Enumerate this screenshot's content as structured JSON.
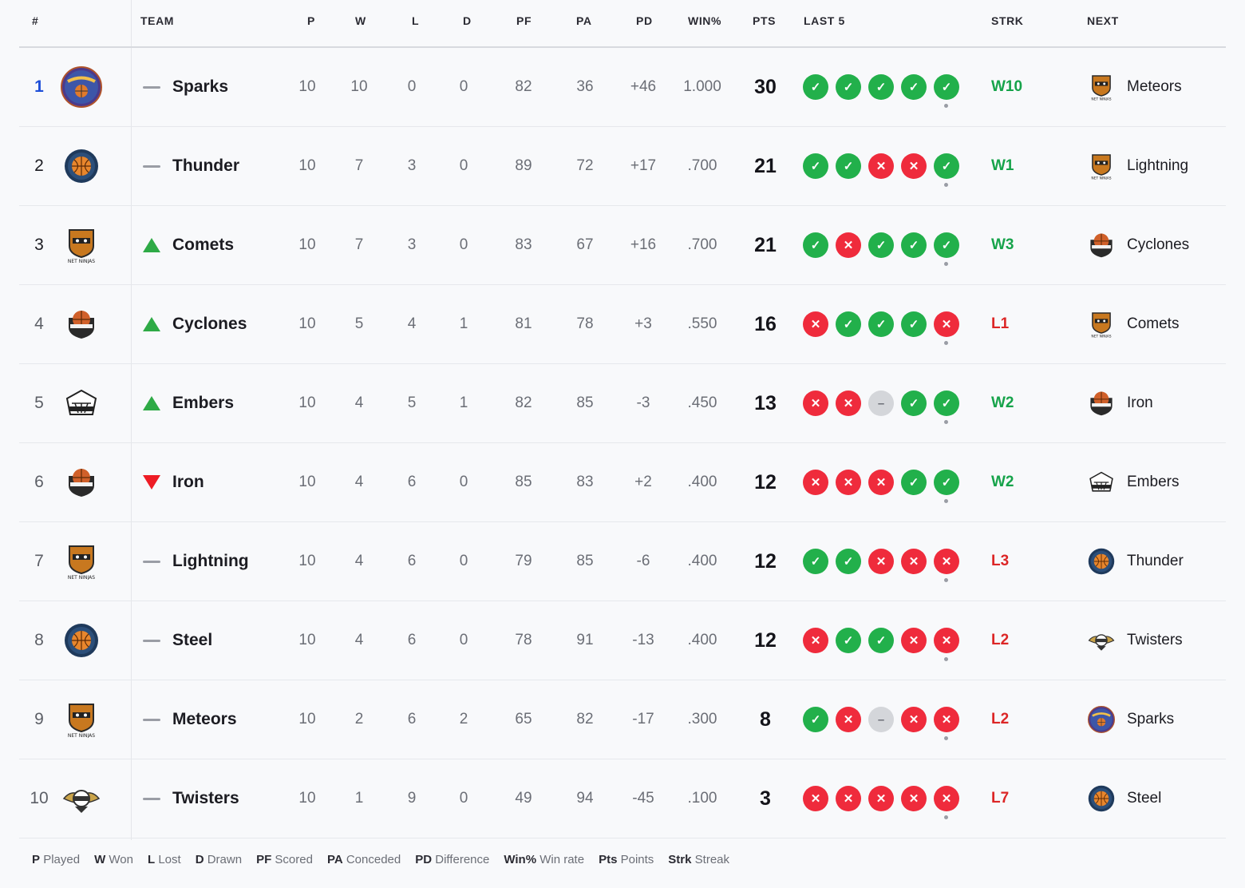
{
  "headers": {
    "rank": "#",
    "team": "TEAM",
    "p": "P",
    "w": "W",
    "l": "L",
    "d": "D",
    "pf": "PF",
    "pa": "PA",
    "pd": "PD",
    "winpct": "WIN%",
    "pts": "PTS",
    "last5": "LAST 5",
    "strk": "STRK",
    "next": "NEXT"
  },
  "colors": {
    "win": "#22b04b",
    "loss": "#ef2b3c",
    "draw": "#d4d6da",
    "rank_first": "#1d4ed8",
    "up": "#2eaa46",
    "down": "#ee1c25"
  },
  "rows": [
    {
      "rank": "1",
      "logo": "alley-oops-logo",
      "trend": "flat",
      "team": "Sparks",
      "p": "10",
      "w": "10",
      "l": "0",
      "d": "0",
      "pf": "82",
      "pa": "36",
      "pd": "+46",
      "winpct": "1.000",
      "pts": "30",
      "last5": [
        "W",
        "W",
        "W",
        "W",
        "W"
      ],
      "strk": "W10",
      "next": "Meteors",
      "next_logo": "net-ninjas-logo"
    },
    {
      "rank": "2",
      "logo": "basketball-logo",
      "trend": "flat",
      "team": "Thunder",
      "p": "10",
      "w": "7",
      "l": "3",
      "d": "0",
      "pf": "89",
      "pa": "72",
      "pd": "+17",
      "winpct": ".700",
      "pts": "21",
      "last5": [
        "W",
        "W",
        "L",
        "L",
        "W"
      ],
      "strk": "W1",
      "next": "Lightning",
      "next_logo": "net-ninjas-logo"
    },
    {
      "rank": "3",
      "logo": "net-ninjas-logo",
      "trend": "up",
      "team": "Comets",
      "p": "10",
      "w": "7",
      "l": "3",
      "d": "0",
      "pf": "83",
      "pa": "67",
      "pd": "+16",
      "winpct": ".700",
      "pts": "21",
      "last5": [
        "W",
        "L",
        "W",
        "W",
        "W"
      ],
      "strk": "W3",
      "next": "Cyclones",
      "next_logo": "shield-ball-logo"
    },
    {
      "rank": "4",
      "logo": "shield-ball-logo",
      "trend": "up",
      "team": "Cyclones",
      "p": "10",
      "w": "5",
      "l": "4",
      "d": "1",
      "pf": "81",
      "pa": "78",
      "pd": "+3",
      "winpct": ".550",
      "pts": "16",
      "last5": [
        "L",
        "W",
        "W",
        "W",
        "L"
      ],
      "strk": "L1",
      "next": "Comets",
      "next_logo": "net-ninjas-logo"
    },
    {
      "rank": "5",
      "logo": "hoop-badge-logo",
      "trend": "up",
      "team": "Embers",
      "p": "10",
      "w": "4",
      "l": "5",
      "d": "1",
      "pf": "82",
      "pa": "85",
      "pd": "-3",
      "winpct": ".450",
      "pts": "13",
      "last5": [
        "L",
        "L",
        "D",
        "W",
        "W"
      ],
      "strk": "W2",
      "next": "Iron",
      "next_logo": "shield-ball-logo"
    },
    {
      "rank": "6",
      "logo": "shield-ball-logo",
      "trend": "down",
      "team": "Iron",
      "p": "10",
      "w": "4",
      "l": "6",
      "d": "0",
      "pf": "85",
      "pa": "83",
      "pd": "+2",
      "winpct": ".400",
      "pts": "12",
      "last5": [
        "L",
        "L",
        "L",
        "W",
        "W"
      ],
      "strk": "W2",
      "next": "Embers",
      "next_logo": "hoop-badge-logo"
    },
    {
      "rank": "7",
      "logo": "net-ninjas-logo",
      "trend": "flat",
      "team": "Lightning",
      "p": "10",
      "w": "4",
      "l": "6",
      "d": "0",
      "pf": "79",
      "pa": "85",
      "pd": "-6",
      "winpct": ".400",
      "pts": "12",
      "last5": [
        "W",
        "W",
        "L",
        "L",
        "L"
      ],
      "strk": "L3",
      "next": "Thunder",
      "next_logo": "basketball-logo"
    },
    {
      "rank": "8",
      "logo": "basketball-logo",
      "trend": "flat",
      "team": "Steel",
      "p": "10",
      "w": "4",
      "l": "6",
      "d": "0",
      "pf": "78",
      "pa": "91",
      "pd": "-13",
      "winpct": ".400",
      "pts": "12",
      "last5": [
        "L",
        "W",
        "W",
        "L",
        "L"
      ],
      "strk": "L2",
      "next": "Twisters",
      "next_logo": "winged-ball-logo"
    },
    {
      "rank": "9",
      "logo": "net-ninjas-logo",
      "trend": "flat",
      "team": "Meteors",
      "p": "10",
      "w": "2",
      "l": "6",
      "d": "2",
      "pf": "65",
      "pa": "82",
      "pd": "-17",
      "winpct": ".300",
      "pts": "8",
      "last5": [
        "W",
        "L",
        "D",
        "L",
        "L"
      ],
      "strk": "L2",
      "next": "Sparks",
      "next_logo": "alley-oops-logo"
    },
    {
      "rank": "10",
      "logo": "winged-ball-logo",
      "trend": "flat",
      "team": "Twisters",
      "p": "10",
      "w": "1",
      "l": "9",
      "d": "0",
      "pf": "49",
      "pa": "94",
      "pd": "-45",
      "winpct": ".100",
      "pts": "3",
      "last5": [
        "L",
        "L",
        "L",
        "L",
        "L"
      ],
      "strk": "L7",
      "next": "Steel",
      "next_logo": "basketball-logo"
    }
  ],
  "legend": [
    {
      "abbr": "P",
      "text": "Played"
    },
    {
      "abbr": "W",
      "text": "Won"
    },
    {
      "abbr": "L",
      "text": "Lost"
    },
    {
      "abbr": "D",
      "text": "Drawn"
    },
    {
      "abbr": "PF",
      "text": "Scored"
    },
    {
      "abbr": "PA",
      "text": "Conceded"
    },
    {
      "abbr": "PD",
      "text": "Difference"
    },
    {
      "abbr": "Win%",
      "text": "Win rate"
    },
    {
      "abbr": "Pts",
      "text": "Points"
    },
    {
      "abbr": "Strk",
      "text": "Streak"
    }
  ]
}
